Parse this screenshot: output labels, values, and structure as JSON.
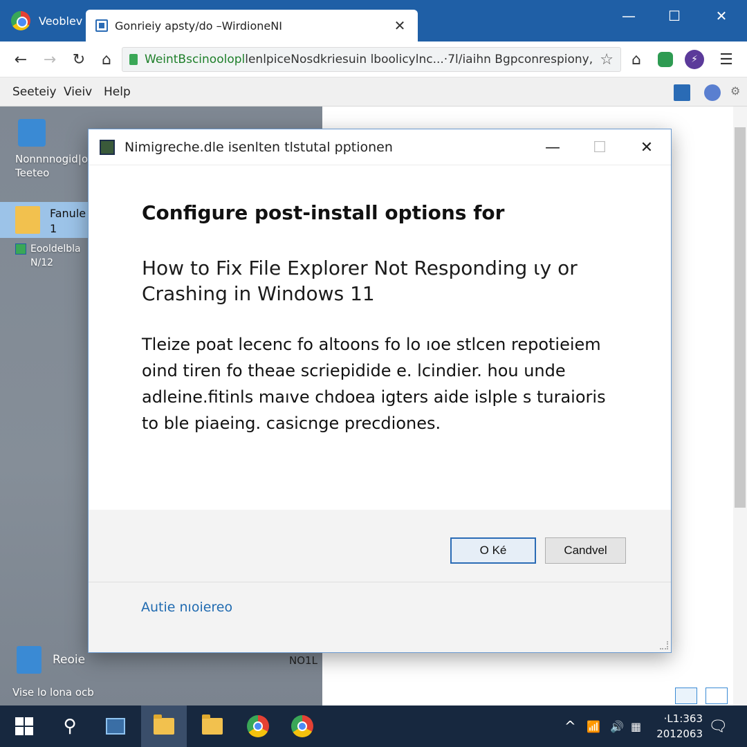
{
  "browser": {
    "tabs": [
      {
        "label": "Veoblev",
        "active": false
      },
      {
        "label": "Gonrieiy apsty/do –WirdioneNI",
        "active": true
      }
    ],
    "window_controls": {
      "minimize": "—",
      "maximize": "☐",
      "close": "✕"
    },
    "toolbar": {
      "back": "←",
      "forward": "→",
      "reload": "↻",
      "home": "⌂",
      "url_domain": "WeintBscinoolopl",
      "url_rest": "lenl­piceNosdkriesuin lboolicylnc...·7l/iaihn Bgpconrespiony,",
      "star": "☆",
      "home_right": "⌂",
      "menu": "☰"
    },
    "menu": {
      "items": [
        "Seeteiy",
        "Vieiv",
        "Help"
      ]
    }
  },
  "desktop": {
    "icons": [
      {
        "label": "Nonnnnogid|o Teeteo"
      },
      {
        "label": "Fanule 1"
      },
      {
        "label": "Eooldelbla N/12"
      },
      {
        "label": "Reoie"
      },
      {
        "label": "Vise lo lona ocb"
      }
    ],
    "page_fragment": "NO1L"
  },
  "dialog": {
    "title": "Nimigreche.dle isenlten tlstutal pptionen",
    "controls": {
      "minimize": "—",
      "maximize": "☐",
      "close": "✕"
    },
    "heading": "Configure post-install options for",
    "subheading": "How to Fix File Explorer Not Responding ɩy or Crashing in Windows 11",
    "body": "Tleize poat lecenc fo altoons fo lo ıoe stlcen repotieiem oind tiren fo theae scriepidide e. lcindier. hou unde adleine.fitinls maıve chdoea igters aide islple s turaioris to ble piaeing. casicnge precdiones.",
    "ok_label": "O Ké",
    "cancel_label": "Candvel",
    "link_label": "Autie nıoiereo"
  },
  "taskbar": {
    "clock_time": "·L1:363",
    "clock_date": "2012063",
    "tray_up": "^"
  },
  "colors": {
    "titlebar": "#1f5fa6",
    "taskbar": "#17283f",
    "accent": "#2a6bb5",
    "link": "#1f6ab0"
  }
}
